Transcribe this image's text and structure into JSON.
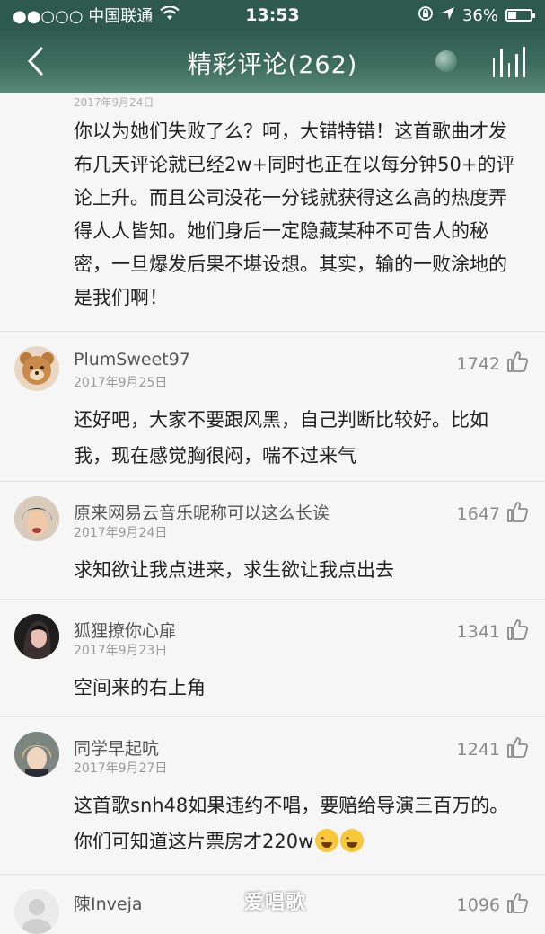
{
  "status_bar": {
    "carrier": "●●○○○ 中国联通",
    "time": "13:53",
    "battery": "36%"
  },
  "nav": {
    "title": "精彩评论(262)"
  },
  "first_comment": {
    "date_fragment": "2017年9月24日",
    "text": "你以为她们失败了么？呵，大错特错！这首歌曲才发布几天评论就已经2w+同时也正在以每分钟50+的评论上升。而且公司没花一分钱就获得这么高的热度弄得人人皆知。她们身后一定隐藏某种不可告人的秘密，一旦爆发后果不堪设想。其实，输的一败涂地的是我们啊！"
  },
  "comments": [
    {
      "user": "PlumSweet97",
      "date": "2017年9月25日",
      "likes": "1742",
      "text": "还好吧，大家不要跟风黑，自己判断比较好。比如我，现在感觉胸很闷，喘不过来气"
    },
    {
      "user": "原来网易云音乐昵称可以这么长诶",
      "date": "2017年9月24日",
      "likes": "1647",
      "text": "求知欲让我点进来，求生欲让我点出去"
    },
    {
      "user": "狐狸撩你心扉",
      "date": "2017年9月23日",
      "likes": "1341",
      "text": "空间来的右上角"
    },
    {
      "user": "同学早起吭",
      "date": "2017年9月27日",
      "likes": "1241",
      "text": "这首歌snh48如果违约不唱，要赔给导演三百万的。你们可知道这片票房才220w"
    },
    {
      "user": "陳Inveja",
      "date": "",
      "likes": "1096",
      "text": ""
    }
  ],
  "watermark": "爱唱歌",
  "colors": {
    "header": "#2e5a4e",
    "background": "#f6f6f6"
  }
}
